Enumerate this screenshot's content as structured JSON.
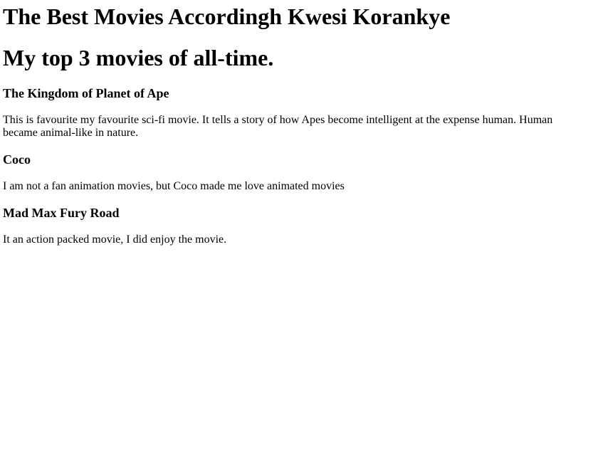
{
  "page": {
    "title": "The Best Movies Accordingh Kwesi Korankye",
    "subtitle": "My top 3 movies of all-time."
  },
  "movies": [
    {
      "title": "The Kingdom of Planet of Ape",
      "description": "This is favourite my favourite sci-fi movie. It tells a story of how Apes become intelligent at the expense human. Human became animal-like in nature."
    },
    {
      "title": "Coco",
      "description": "I am not a fan animation movies, but Coco made me love animated movies"
    },
    {
      "title": "Mad Max Fury Road",
      "description": "It an action packed movie, I did enjoy the movie."
    }
  ]
}
